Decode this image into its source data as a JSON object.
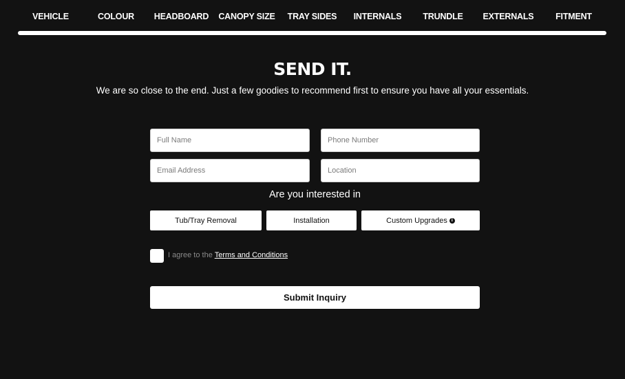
{
  "steps": [
    "VEHICLE",
    "COLOUR",
    "HEADBOARD",
    "CANOPY SIZE",
    "TRAY SIDES",
    "INTERNALS",
    "TRUNDLE",
    "EXTERNALS",
    "FITMENT"
  ],
  "progress": 1.0,
  "page": {
    "heading": "SEND IT.",
    "subtitle": "We are so close to the end. Just a few goodies to recommend first to ensure you have all your essentials."
  },
  "form": {
    "full_name_placeholder": "Full Name",
    "phone_placeholder": "Phone Number",
    "email_placeholder": "Email Address",
    "location_placeholder": "Location",
    "interest_label": "Are you interested in",
    "options": [
      "Tub/Tray Removal",
      "Installation",
      "Custom Upgrades"
    ],
    "info_icon": "info-icon",
    "agree_prefix": "I agree to the ",
    "terms_link": "Terms and Conditions",
    "submit_label": "Submit Inquiry"
  },
  "colors": {
    "background": "#121212",
    "foreground": "#ffffff",
    "muted_text": "#8a8a8a"
  }
}
